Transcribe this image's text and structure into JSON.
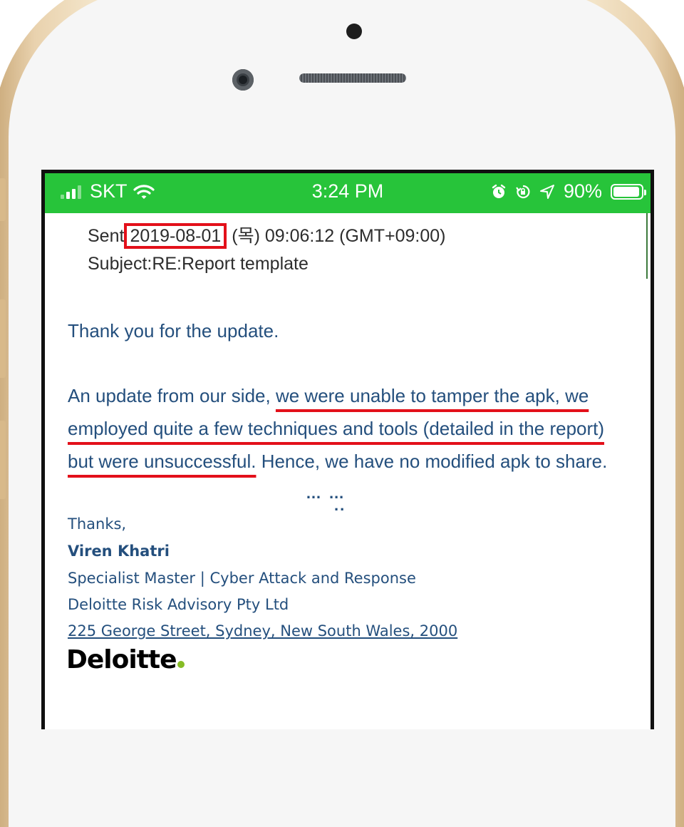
{
  "status_bar": {
    "carrier": "SKT",
    "time": "3:24 PM",
    "battery": "90%",
    "colors": {
      "bar": "#27c43a"
    }
  },
  "email_header": {
    "sent_label": "Sent",
    "sent_date": "2019-08-01",
    "sent_rest": " (목) 09:06:12 (GMT+09:00)",
    "subject_line": "Subject:RE:Report template"
  },
  "message": {
    "greeting": "Thank you for the update.",
    "body_intro": "An update from our side, ",
    "body_highlight": "we were unable to tamper the apk, we employed quite a few techniques and tools (detailed in the report) but were unsuccessful.",
    "body_rest": " Hence, we have no modified apk to share."
  },
  "signature": {
    "sign_off": "Thanks,",
    "name": "Viren Khatri",
    "title": "Specialist Master | Cyber Attack and Response",
    "company": "Deloitte Risk Advisory Pty Ltd",
    "address": "225 George Street, Sydney, New South Wales, 2000",
    "logo": "Deloitte"
  },
  "annotations": {
    "highlight_color": "#e3101a"
  },
  "icons": [
    "signal-icon",
    "wifi-icon",
    "alarm-icon",
    "rotation-lock-icon",
    "location-icon",
    "battery-icon"
  ]
}
